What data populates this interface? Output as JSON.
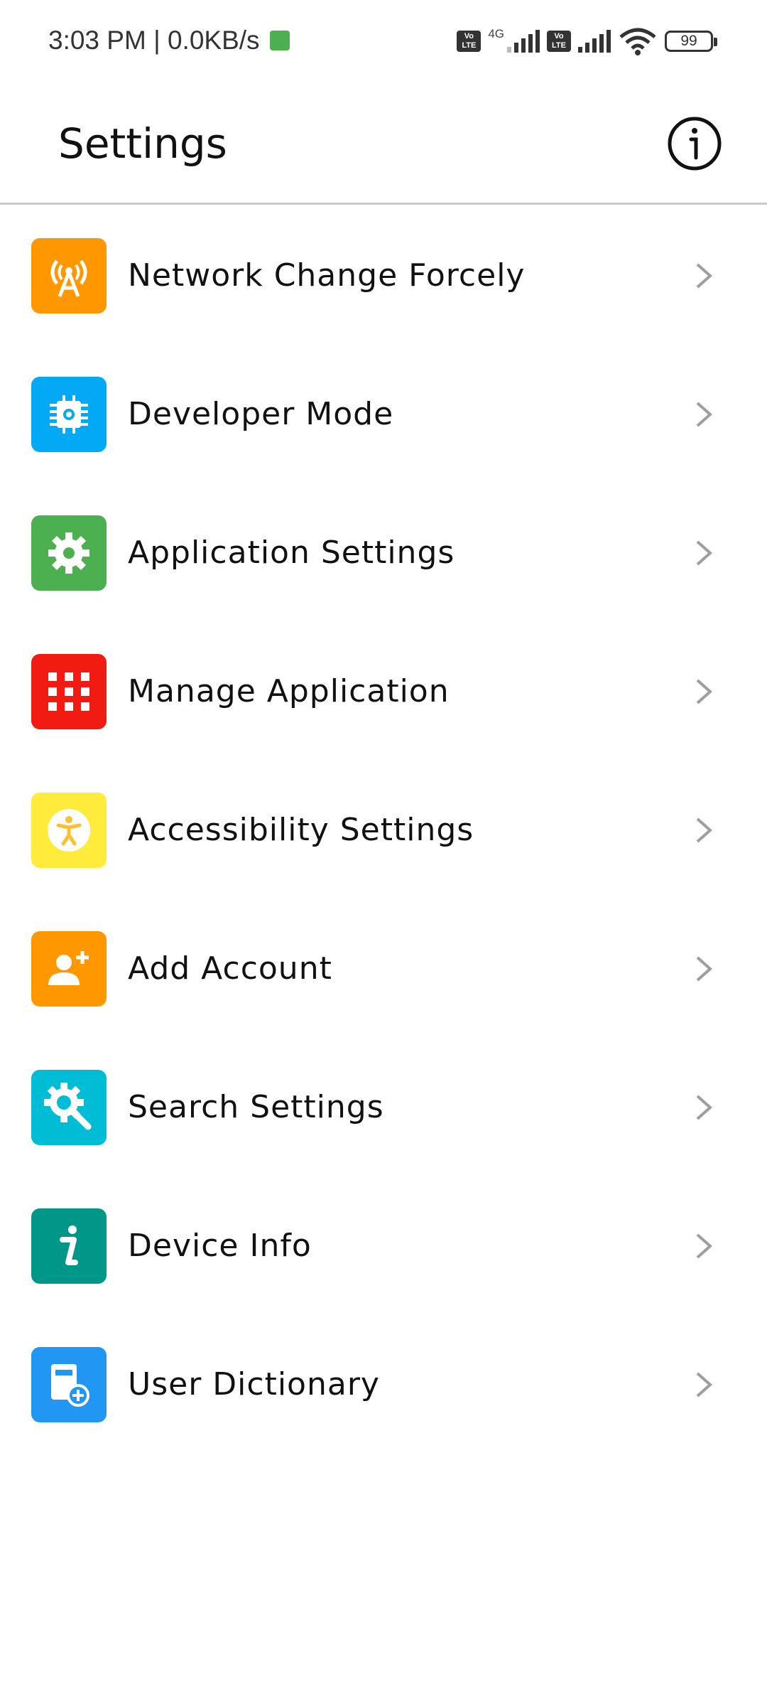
{
  "status_bar": {
    "time_speed": "3:03 PM | 0.0KB/s",
    "network_type": "4G",
    "volte_label_top": "Vo",
    "volte_label_bottom": "LTE",
    "battery": "99"
  },
  "app_bar": {
    "title": "Settings",
    "info_icon": "info-circle-icon"
  },
  "settings_items": [
    {
      "label": "Network Change Forcely",
      "icon": "antenna-icon",
      "color": "#ff9800"
    },
    {
      "label": "Developer Mode",
      "icon": "chip-icon",
      "color": "#03a9f4"
    },
    {
      "label": "Application Settings",
      "icon": "gear-icon",
      "color": "#4caf50"
    },
    {
      "label": "Manage Application",
      "icon": "grid-icon",
      "color": "#f21b12"
    },
    {
      "label": "Accessibility Settings",
      "icon": "accessibility-icon",
      "color": "#ffeb3b"
    },
    {
      "label": "Add Account",
      "icon": "add-person-icon",
      "color": "#ff9800"
    },
    {
      "label": "Search Settings",
      "icon": "gear-search-icon",
      "color": "#00bcd4"
    },
    {
      "label": "Device Info",
      "icon": "info-icon",
      "color": "#009688"
    },
    {
      "label": "User Dictionary",
      "icon": "dictionary-add-icon",
      "color": "#2196f3"
    }
  ]
}
